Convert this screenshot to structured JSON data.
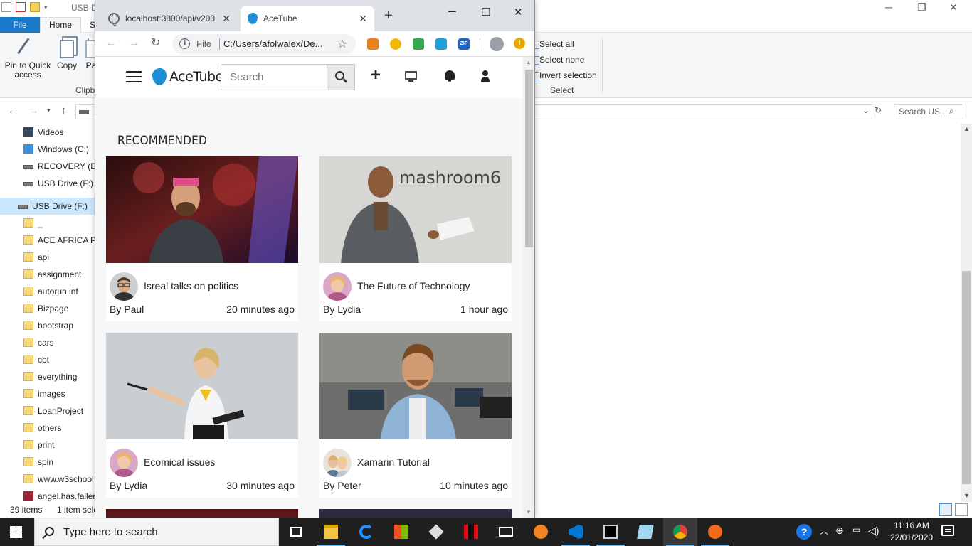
{
  "explorer": {
    "title_partial": "USB D",
    "ribbon_tabs": [
      "File",
      "Home",
      "S"
    ],
    "clipboard": {
      "pin_label": "Pin to Quick access",
      "copy_label": "Copy",
      "paste_label": "Pa",
      "group_label": "Clipb"
    },
    "select": {
      "select_all": "Select all",
      "select_none": "Select none",
      "invert_selection": "Invert selection",
      "group_label": "Select"
    },
    "search_placeholder": "Search US...",
    "nav_items": [
      {
        "label": "Videos",
        "icon": "videos-folder-icon"
      },
      {
        "label": "Windows (C:)",
        "icon": "windows-drive-icon"
      },
      {
        "label": "RECOVERY (D:)",
        "icon": "drive-icon"
      },
      {
        "label": "USB Drive (F:)",
        "icon": "usb-drive-icon"
      },
      {
        "label": "USB Drive (F:)",
        "icon": "usb-drive-icon",
        "selected": true
      },
      {
        "label": "_",
        "icon": "folder-icon"
      },
      {
        "label": "ACE AFRICA PA",
        "icon": "folder-icon"
      },
      {
        "label": "api",
        "icon": "folder-icon"
      },
      {
        "label": "assignment",
        "icon": "folder-icon"
      },
      {
        "label": "autorun.inf",
        "icon": "folder-icon"
      },
      {
        "label": "Bizpage",
        "icon": "folder-icon"
      },
      {
        "label": "bootstrap",
        "icon": "folder-icon"
      },
      {
        "label": "cars",
        "icon": "folder-icon"
      },
      {
        "label": "cbt",
        "icon": "folder-icon"
      },
      {
        "label": "everything",
        "icon": "folder-icon"
      },
      {
        "label": "images",
        "icon": "folder-icon"
      },
      {
        "label": "LoanProject",
        "icon": "folder-icon"
      },
      {
        "label": "others",
        "icon": "folder-icon"
      },
      {
        "label": "print",
        "icon": "folder-icon"
      },
      {
        "label": "spin",
        "icon": "folder-icon"
      },
      {
        "label": "www.w3school",
        "icon": "folder-icon"
      },
      {
        "label": "angel.has.fallen",
        "icon": "rar-file-icon"
      }
    ],
    "status": {
      "items_count": "39 items",
      "selected": "1 item sele"
    }
  },
  "chrome": {
    "tabs": [
      {
        "title": "localhost:3800/api/v200",
        "icon": "globe-icon",
        "active": false
      },
      {
        "title": "AceTube",
        "icon": "acetube-favicon",
        "active": true
      }
    ],
    "omnibox": {
      "scheme": "File",
      "url": "C:/Users/afolwalex/De..."
    },
    "extension_labels": {
      "zip": "ZIP"
    },
    "update_label": "!"
  },
  "app": {
    "brand": "AceTube",
    "search_placeholder": "Search",
    "section_title": "RECOMMENDED",
    "videos": [
      {
        "title": "Isreal talks on politics",
        "author": "By Paul",
        "time": "20 minutes ago",
        "thumb": "speaker-stage",
        "avatar": "man-glasses"
      },
      {
        "title": "The Future of Technology",
        "author": "By Lydia",
        "time": "1 hour ago",
        "thumb": "presenter-mashroom",
        "avatar": "woman-pink"
      },
      {
        "title": "Ecomical issues",
        "author": "By Lydia",
        "time": "30 minutes ago",
        "thumb": "woman-pointing",
        "avatar": "woman-pink"
      },
      {
        "title": "Xamarin Tutorial",
        "author": "By Peter",
        "time": "10 minutes ago",
        "thumb": "smiling-man-office",
        "avatar": "couple"
      }
    ],
    "thumb_text": {
      "mashroom": "mashroom6"
    }
  },
  "taskbar": {
    "search_text": "Type here to search",
    "time": "11:16 AM",
    "date": "22/01/2020",
    "help_label": "?"
  },
  "colors": {
    "accent": "#1979ca",
    "logo_blue": "#1e8fd6",
    "taskbar": "#1f1f1f"
  }
}
